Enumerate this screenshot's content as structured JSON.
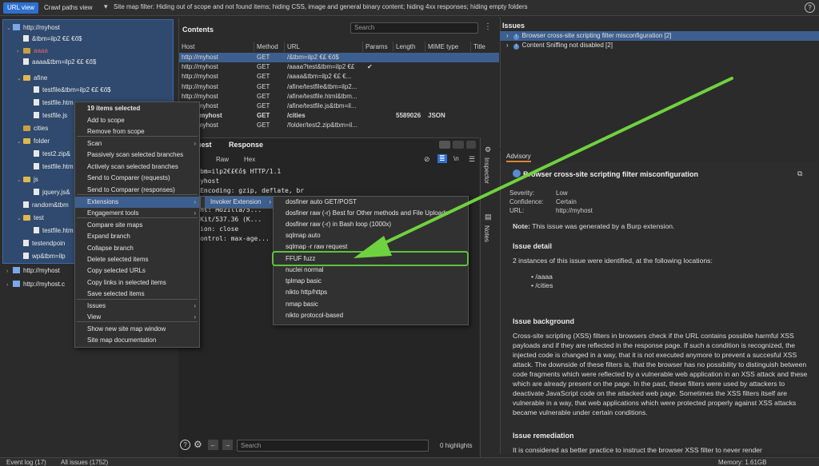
{
  "topbar": {
    "tabs": [
      "URL view",
      "Crawl paths view"
    ],
    "filter": "Site map filter: Hiding out of scope and not found items;  hiding CSS, image and general binary content;  hiding 4xx responses;  hiding empty folders",
    "help": "?"
  },
  "tree": [
    {
      "label": "http://myhost",
      "kind": "host",
      "indent": 0,
      "toggle": "⌄"
    },
    {
      "label": "&tbm=ilp2 €£    €ő$",
      "kind": "file",
      "indent": 1,
      "toggle": ""
    },
    {
      "label": "aaaa",
      "kind": "gear",
      "indent": 1,
      "toggle": "›"
    },
    {
      "label": "aaaa&tbm=ilp2 €£    €ő$",
      "kind": "file",
      "indent": 1,
      "toggle": ""
    },
    {
      "label": "afine",
      "kind": "folder",
      "indent": 1,
      "toggle": "⌄"
    },
    {
      "label": "testfile&tbm=ilp2 €£    €ő$",
      "kind": "file",
      "indent": 2,
      "toggle": ""
    },
    {
      "label": "testfile.htm",
      "kind": "file",
      "indent": 2,
      "toggle": ""
    },
    {
      "label": "testfile.js",
      "kind": "file",
      "indent": 2,
      "toggle": ""
    },
    {
      "label": "cities",
      "kind": "gear",
      "indent": 1,
      "toggle": ""
    },
    {
      "label": "folder",
      "kind": "folder",
      "indent": 1,
      "toggle": "⌄"
    },
    {
      "label": "test2.zip&",
      "kind": "file",
      "indent": 2,
      "toggle": ""
    },
    {
      "label": "testfile.htm",
      "kind": "file",
      "indent": 2,
      "toggle": ""
    },
    {
      "label": "js",
      "kind": "folder",
      "indent": 1,
      "toggle": "⌄"
    },
    {
      "label": "jquery.js&",
      "kind": "file",
      "indent": 2,
      "toggle": ""
    },
    {
      "label": "random&tbm",
      "kind": "file",
      "indent": 1,
      "toggle": ""
    },
    {
      "label": "test",
      "kind": "folder",
      "indent": 1,
      "toggle": "⌄"
    },
    {
      "label": "testfile.htm",
      "kind": "file",
      "indent": 2,
      "toggle": ""
    },
    {
      "label": "testendpoin",
      "kind": "file",
      "indent": 1,
      "toggle": ""
    },
    {
      "label": "wp&tbm=ilp",
      "kind": "file",
      "indent": 1,
      "toggle": ""
    },
    {
      "label": "http://myhost",
      "kind": "host",
      "indent": 0,
      "toggle": "›"
    },
    {
      "label": "http://myhost.c",
      "kind": "host",
      "indent": 0,
      "toggle": "›"
    }
  ],
  "contents": {
    "title": "Contents",
    "search_placeholder": "Search",
    "menu": "⋮",
    "columns": [
      "Host",
      "Method",
      "URL",
      "Params",
      "Length",
      "MIME type",
      "Title"
    ],
    "rows": [
      {
        "host": "http://myhost",
        "method": "GET",
        "url": "/&tbm=ilp2 €£    €ő$",
        "params": "",
        "length": "",
        "mime": ""
      },
      {
        "host": "http://myhost",
        "method": "GET",
        "url": "/aaaa?test&tbm=ilp2 €£",
        "params": "✔",
        "length": "",
        "mime": ""
      },
      {
        "host": "http://myhost",
        "method": "GET",
        "url": "/aaaa&tbm=ilp2 €£    €...",
        "params": "",
        "length": "",
        "mime": ""
      },
      {
        "host": "http://myhost",
        "method": "GET",
        "url": "/afine/testfile&tbm=ilp2...",
        "params": "",
        "length": "",
        "mime": ""
      },
      {
        "host": "http://myhost",
        "method": "GET",
        "url": "/afine/testfile.html&tbm...",
        "params": "",
        "length": "",
        "mime": ""
      },
      {
        "host": "http://myhost",
        "method": "GET",
        "url": "/afine/testfile.js&tbm=il...",
        "params": "",
        "length": "",
        "mime": ""
      },
      {
        "host": "http://myhost",
        "method": "GET",
        "url": "/cities",
        "params": "",
        "length": "5589026",
        "mime": "JSON"
      },
      {
        "host": "http://myhost",
        "method": "GET",
        "url": "/folder/test2.zip&tbm=il...",
        "params": "",
        "length": "",
        "mime": ""
      }
    ]
  },
  "request": {
    "tabs": [
      "uest",
      "Response"
    ],
    "subtabs": [
      "y",
      "Raw",
      "Hex"
    ],
    "icons": [
      "⊘",
      "≣",
      "\\n",
      "☰"
    ],
    "lines": [
      "T /&tbm=ilp2€£€ő$ HTTP/1.1",
      "st: myhost",
      "cept-Encoding: gzip, deflate, br",
      "cept: */*",
      "r-Agent: Mozilla/5...",
      "leWebKit/537.36 (K...",
      "nnection: close",
      "che-Control: max-age..."
    ],
    "search_placeholder": "Search",
    "highlights": "0 highlights"
  },
  "side_tabs": [
    "Inspector",
    "Notes"
  ],
  "issues": {
    "title": "Issues",
    "items": [
      "Browser cross-site scripting filter misconfiguration [2]",
      "Content Sniffing not disabled [2]"
    ]
  },
  "advisory": {
    "tab": "Advisory",
    "title": "Browser cross-site scripting filter misconfiguration",
    "severity_label": "Severity:",
    "severity": "Low",
    "confidence_label": "Confidence:",
    "confidence": "Certain",
    "url_label": "URL:",
    "url": "http://myhost",
    "note_label": "Note:",
    "note": "This issue was generated by a Burp extension.",
    "detail_title": "Issue detail",
    "detail_text": "2 instances of this issue were identified, at the following locations:",
    "locations": [
      "/aaaa",
      "/cities"
    ],
    "background_title": "Issue background",
    "background_text": "Cross-site scripting (XSS) filters in browsers check if the URL contains possible harmful XSS payloads and if they are reflected in the response page. If such a condition is recognized, the injected code is changed in a way, that it is not executed anymore to prevent a succesful XSS attack. The downside of these filters is, that the browser has no possibility to distinguish between code fragments which were reflected by a vulnerable web application in an XSS attack and these which are already present on the page. In the past, these filters were used by attackers to deactivate JavaScript code on the attacked web page. Sometimes the XSS filters itself are vulnerable in a way, that web applications which were protected properly against XSS attacks became vulnerable under certain conditions.",
    "remediation_title": "Issue remediation",
    "remediation_text": "It is considered as better practice to instruct the browser XSS filter to never render"
  },
  "context_menu": {
    "header": "19 items selected",
    "items": [
      {
        "label": "Add to scope",
        "sub": false
      },
      {
        "label": "Remove from scope",
        "sub": false
      },
      {
        "label": "Scan",
        "sub": true
      },
      {
        "label": "Passively scan selected branches",
        "sub": false
      },
      {
        "label": "Actively scan selected branches",
        "sub": false
      },
      {
        "label": "Send to Comparer (requests)",
        "sub": false
      },
      {
        "label": "Send to Comparer (responses)",
        "sub": false
      },
      {
        "label": "Extensions",
        "sub": true
      },
      {
        "label": "Engagement tools",
        "sub": true
      },
      {
        "label": "Compare site maps",
        "sub": false
      },
      {
        "label": "Expand branch",
        "sub": false
      },
      {
        "label": "Collapse branch",
        "sub": false
      },
      {
        "label": "Delete selected items",
        "sub": false
      },
      {
        "label": "Copy selected URLs",
        "sub": false
      },
      {
        "label": "Copy links in selected items",
        "sub": false
      },
      {
        "label": "Save selected items",
        "sub": false
      },
      {
        "label": "Issues",
        "sub": true
      },
      {
        "label": "View",
        "sub": true
      },
      {
        "label": "Show new site map window",
        "sub": false
      },
      {
        "label": "Site map documentation",
        "sub": false
      }
    ],
    "submenu": "Invoker Extension",
    "submenu_items": [
      "dosfiner auto GET/POST",
      "dosfiner raw (-r) Best for Other methods and File Uploads",
      "dosfiner raw (-r) in Bash loop (1000x)",
      "sqlmap auto",
      "sqlmap -r raw request",
      "FFUF fuzz",
      "nuclei normal",
      "tplmap basic",
      "nikto http/https",
      "nmap basic",
      "nikto protocol-based"
    ]
  },
  "status": {
    "event_log": "Event log (17)",
    "all_issues": "All issues (1752)",
    "memory": "Memory: 1.61GB"
  },
  "colors": {
    "accent": "#3d5f8f",
    "highlight_box": "#5ec23b",
    "arrow": "#6fd23f",
    "tab_active": "#2f6fd0"
  }
}
